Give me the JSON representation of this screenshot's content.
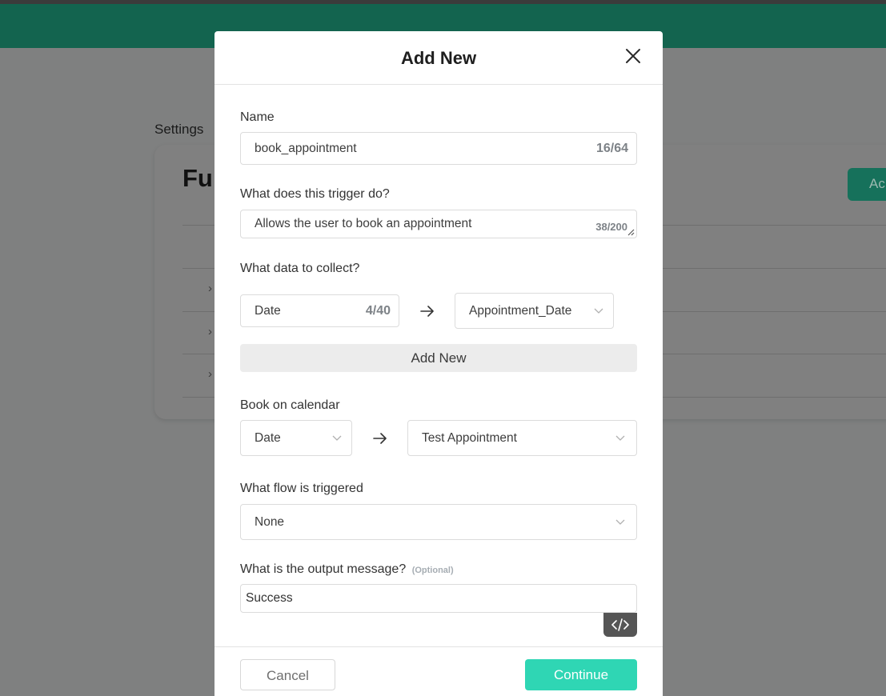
{
  "background": {
    "breadcrumb": "Settings",
    "card_title": "Fu",
    "add_button_label": "Ac",
    "row_chevron": "›"
  },
  "modal": {
    "title": "Add New",
    "fields": {
      "name": {
        "label": "Name",
        "value": "book_appointment",
        "counter": "16/64"
      },
      "description": {
        "label": "What does this trigger do?",
        "value": "Allows the user to book an appointment",
        "counter": "38/200"
      },
      "data_collect": {
        "label": "What data to collect?",
        "value": "Date",
        "counter": "4/40",
        "mapped_to": "Appointment_Date",
        "add_label": "Add New"
      },
      "calendar": {
        "label": "Book on calendar",
        "date_field": "Date",
        "calendar_name": "Test Appointment"
      },
      "flow": {
        "label": "What flow is triggered",
        "value": "None"
      },
      "output": {
        "label": "What is the output message?",
        "optional": "(Optional)",
        "value": "Success"
      }
    },
    "footer": {
      "cancel_label": "Cancel",
      "continue_label": "Continue"
    }
  },
  "colors": {
    "header_green": "#13644f",
    "accent_teal": "#2fd6b4",
    "overlay": "#7f8080"
  },
  "icons": [
    "close-icon",
    "arrow-right-icon",
    "chevron-down-icon",
    "code-icon",
    "resize-handle-icon"
  ]
}
